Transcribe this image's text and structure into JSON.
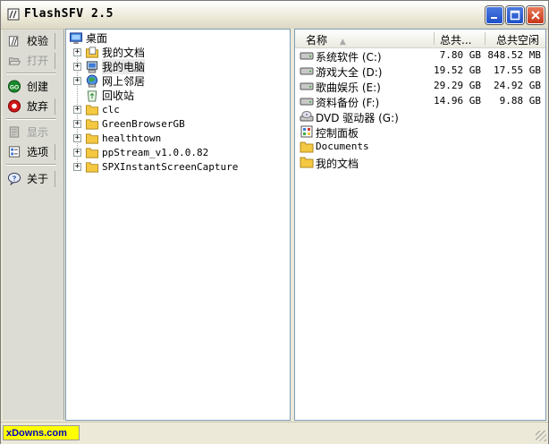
{
  "window": {
    "title": "FlashSFV 2.5"
  },
  "toolbar": {
    "items": [
      {
        "label": "校验",
        "icon": "verify-icon",
        "enabled": true
      },
      {
        "label": "打开",
        "icon": "open-icon",
        "enabled": false
      },
      {
        "label": "创建",
        "icon": "create-go-icon",
        "enabled": true
      },
      {
        "label": "放弃",
        "icon": "abort-icon",
        "enabled": true
      },
      {
        "label": "显示",
        "icon": "display-icon",
        "enabled": false
      },
      {
        "label": "选项",
        "icon": "options-icon",
        "enabled": true
      },
      {
        "label": "关于",
        "icon": "about-icon",
        "enabled": true
      }
    ]
  },
  "tree": {
    "root": "桌面",
    "items": [
      {
        "label": "我的文档",
        "type": "my-documents",
        "expandable": true
      },
      {
        "label": "我的电脑",
        "type": "my-computer",
        "expandable": true,
        "selected": true
      },
      {
        "label": "网上邻居",
        "type": "network",
        "expandable": true
      },
      {
        "label": "回收站",
        "type": "recycle-bin",
        "expandable": false
      },
      {
        "label": "clc",
        "type": "folder",
        "expandable": true
      },
      {
        "label": "GreenBrowserGB",
        "type": "folder",
        "expandable": true
      },
      {
        "label": "healthtown",
        "type": "folder",
        "expandable": true
      },
      {
        "label": "ppStream_v1.0.0.82",
        "type": "folder",
        "expandable": true
      },
      {
        "label": "SPXInstantScreenCapture",
        "type": "folder",
        "expandable": true
      }
    ]
  },
  "list": {
    "columns": {
      "name": "名称",
      "total": "总共...",
      "free": "总共空闲"
    },
    "sort_indicator": "▲",
    "rows": [
      {
        "name": "系统软件 (C:)",
        "total": "7.80 GB",
        "free": "848.52 MB",
        "type": "drive"
      },
      {
        "name": "游戏大全 (D:)",
        "total": "19.52 GB",
        "free": "17.55 GB",
        "type": "drive"
      },
      {
        "name": "歌曲娱乐 (E:)",
        "total": "29.29 GB",
        "free": "24.92 GB",
        "type": "drive"
      },
      {
        "name": "资料备份 (F:)",
        "total": "14.96 GB",
        "free": "9.88 GB",
        "type": "drive"
      },
      {
        "name": "DVD 驱动器 (G:)",
        "total": "",
        "free": "",
        "type": "dvd"
      },
      {
        "name": "控制面板",
        "total": "",
        "free": "",
        "type": "control-panel"
      },
      {
        "name": "Documents",
        "total": "",
        "free": "",
        "type": "folder"
      },
      {
        "name": "我的文档",
        "total": "",
        "free": "",
        "type": "folder"
      }
    ]
  },
  "status": {
    "watermark": "xDowns.com"
  },
  "colors": {
    "window_bg": "#ece9d8",
    "pane_border": "#7f9db9",
    "folder": "#f5c842",
    "watermark_bg": "#ffff00"
  }
}
